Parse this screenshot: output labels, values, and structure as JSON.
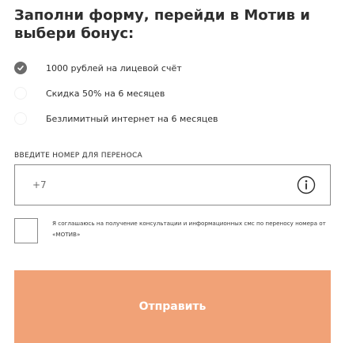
{
  "form": {
    "title": "Заполни форму, перейди в Мотив и выбери бонус:",
    "bonuses": [
      {
        "label": "1000 рублей на лицевой счёт",
        "checked": true
      },
      {
        "label": "Скидка 50% на 6 месяцев",
        "checked": false
      },
      {
        "label": "Безлимитный интернет на 6 месяцев",
        "checked": false
      }
    ],
    "phone_label": "ВВЕДИТЕ НОМЕР ДЛЯ ПЕРЕНОСА",
    "phone_placeholder": "+7",
    "phone_value": "",
    "consent_text": "Я соглашаюсь на получение консультации и информационных смс по переносу номера от «МОТИВ»",
    "consent_checked": false,
    "submit_label": "Отправить"
  },
  "colors": {
    "accent": "#f1a277",
    "radio_checked": "#6b6b6b",
    "border": "#8a8a8a",
    "text": "#2e2e2e"
  },
  "icons": {
    "selected_radio": "check-icon",
    "phone_info": "info-icon"
  }
}
